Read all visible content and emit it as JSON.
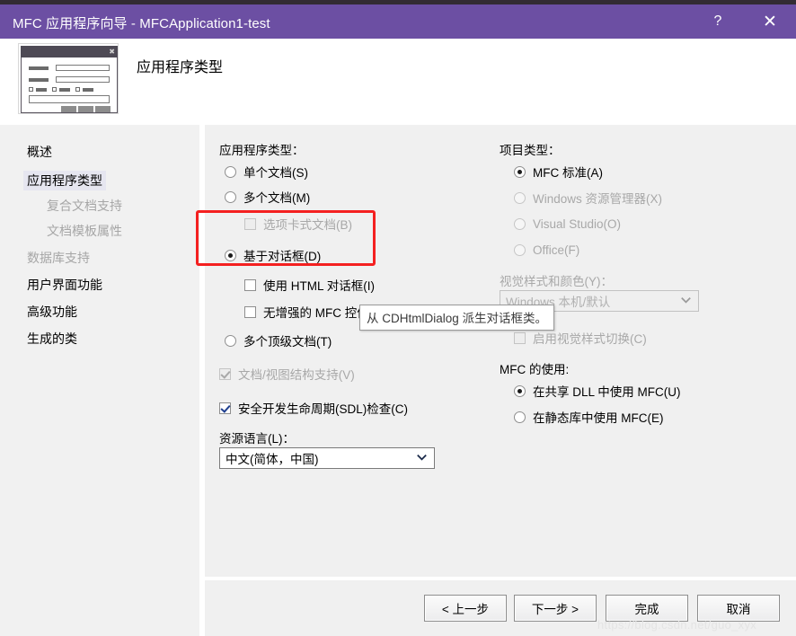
{
  "window": {
    "title": "MFC 应用程序向导 - MFCApplication1-test",
    "help_icon": "?",
    "close_icon": "✕"
  },
  "header": {
    "title": "应用程序类型",
    "icon": "dialog-preview-icon"
  },
  "sidebar": {
    "items": [
      {
        "label": "概述",
        "state": "normal",
        "sub": false
      },
      {
        "label": "应用程序类型",
        "state": "selected",
        "sub": false
      },
      {
        "label": "复合文档支持",
        "state": "disabled",
        "sub": true
      },
      {
        "label": "文档模板属性",
        "state": "disabled",
        "sub": true
      },
      {
        "label": "数据库支持",
        "state": "disabled",
        "sub": false
      },
      {
        "label": "用户界面功能",
        "state": "normal",
        "sub": false
      },
      {
        "label": "高级功能",
        "state": "normal",
        "sub": false
      },
      {
        "label": "生成的类",
        "state": "normal",
        "sub": false
      }
    ]
  },
  "left_column": {
    "app_type_label": "应用程序类型：",
    "options": [
      {
        "label": "单个文档(S)",
        "accel": "S",
        "type": "radio",
        "checked": false,
        "enabled": true
      },
      {
        "label": "多个文档(M)",
        "accel": "M",
        "type": "radio",
        "checked": false,
        "enabled": true
      },
      {
        "label": "选项卡式文档(B)",
        "accel": "B",
        "type": "checkbox",
        "checked": false,
        "enabled": false
      },
      {
        "label": "基于对话框(D)",
        "accel": "D",
        "type": "radio",
        "checked": true,
        "enabled": true
      },
      {
        "label": "使用 HTML 对话框(I)",
        "accel": "I",
        "type": "checkbox",
        "checked": false,
        "enabled": true
      },
      {
        "label": "无增强的 MFC 控件(U)",
        "accel": "U",
        "type": "checkbox",
        "checked": false,
        "enabled": true
      },
      {
        "label": "多个顶级文档(T)",
        "accel": "T",
        "type": "radio",
        "checked": false,
        "enabled": true
      },
      {
        "label": "文档/视图结构支持(V)",
        "accel": "V",
        "type": "checkbox",
        "checked": true,
        "enabled": false
      },
      {
        "label": "安全开发生命周期(SDL)检查(C)",
        "accel": "C",
        "type": "checkbox",
        "checked": true,
        "enabled": true
      }
    ],
    "resource_language_label": "资源语言(L)：",
    "resource_language_value": "中文(简体，中国)"
  },
  "right_column": {
    "project_type_label": "项目类型：",
    "project_types": [
      {
        "label": "MFC 标准(A)",
        "accel": "A",
        "checked": true,
        "enabled": true
      },
      {
        "label": "Windows 资源管理器(X)",
        "accel": "X",
        "checked": false,
        "enabled": false
      },
      {
        "label": "Visual Studio(O)",
        "accel": "O",
        "checked": false,
        "enabled": false
      },
      {
        "label": "Office(F)",
        "accel": "F",
        "checked": false,
        "enabled": false
      }
    ],
    "visual_style_label": "视觉样式和颜色(Y)：",
    "visual_style_value": "Windows 本机/默认",
    "enable_style_switch_label": "启用视觉样式切换(C)",
    "enable_style_switch_checked": false,
    "mfc_usage_label": "MFC 的使用:",
    "mfc_usage_options": [
      {
        "label": "在共享 DLL 中使用 MFC(U)",
        "accel": "U",
        "checked": true
      },
      {
        "label": "在静态库中使用 MFC(E)",
        "accel": "E",
        "checked": false
      }
    ]
  },
  "tooltip": {
    "text": "从 CDHtmlDialog 派生对话框类。"
  },
  "footer": {
    "buttons": [
      {
        "label": "< 上一步"
      },
      {
        "label": "下一步 >"
      },
      {
        "label": "完成"
      },
      {
        "label": "取消"
      }
    ]
  },
  "watermark": {
    "text": "https://blog.csdn.net/guo_xyx"
  },
  "colors": {
    "title_bar": "#6c4fa3",
    "top_strip": "#332b33",
    "panel_bg": "#f0f0f0",
    "sidebar_bg": "#f1f1f1",
    "highlight": "#f42020",
    "selection": "#e6e6f0"
  }
}
